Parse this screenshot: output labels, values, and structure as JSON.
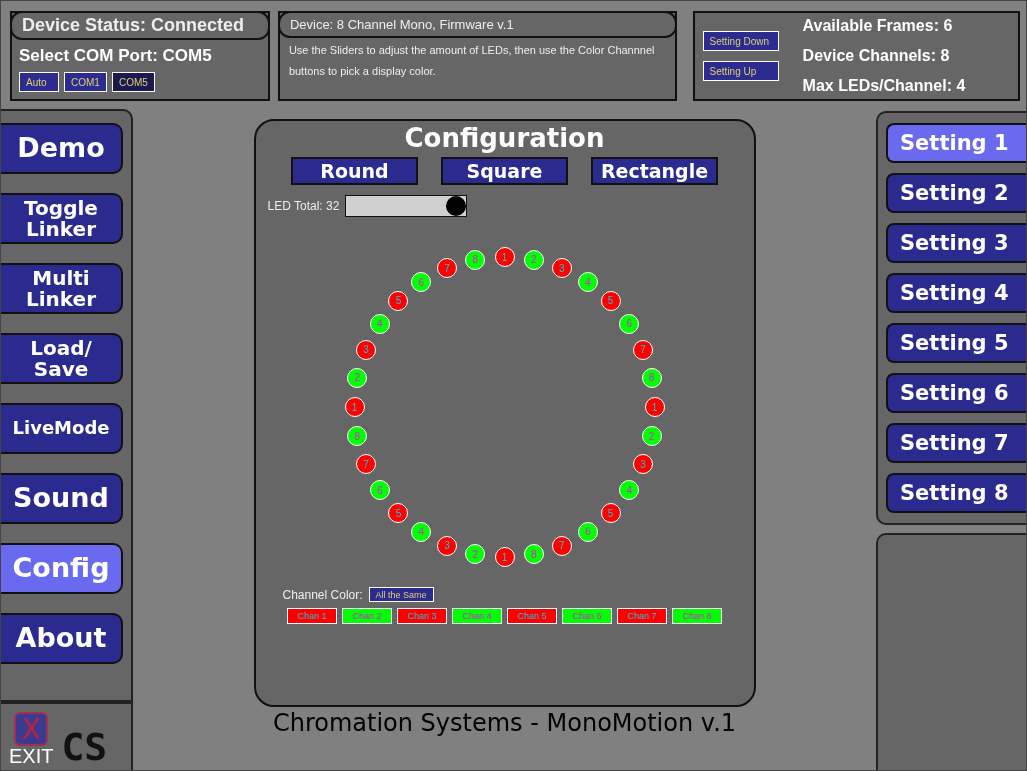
{
  "status": {
    "title": "Device Status: Connected",
    "com_label": "Select COM Port: COM5",
    "ports": [
      {
        "label": "Auto",
        "selected": false
      },
      {
        "label": "COM1",
        "selected": false
      },
      {
        "label": "COM5",
        "selected": true
      }
    ]
  },
  "device": {
    "title": "Device: 8 Channel Mono, Firmware v.1",
    "description": "Use the Sliders to adjust the amount of LEDs, then use the Color Channnel buttons to pick a display color."
  },
  "settings_panel": {
    "buttons": [
      "Setting Down",
      "Setting Up"
    ],
    "info": [
      "Available Frames: 6",
      "Device Channels: 8",
      "Max LEDs/Channel: 4"
    ]
  },
  "sidebar": {
    "items": [
      {
        "label": "Demo",
        "selected": false
      },
      {
        "label": "Toggle Linker",
        "selected": false
      },
      {
        "label": "Multi Linker",
        "selected": false
      },
      {
        "label": "Load/ Save",
        "selected": false
      },
      {
        "label": "LiveMode",
        "selected": false
      },
      {
        "label": "Sound",
        "selected": false
      },
      {
        "label": "Config",
        "selected": true
      },
      {
        "label": "About",
        "selected": false
      }
    ]
  },
  "configuration": {
    "title": "Configuration",
    "shapes": [
      "Round",
      "Square",
      "Rectangle"
    ],
    "led_total": {
      "label": "LED Total: 32",
      "level": 1.0
    },
    "led_ring": {
      "top_arc": [
        {
          "label": "1",
          "color": "#ff0000"
        },
        {
          "label": "2",
          "color": "#00ff00"
        },
        {
          "label": "3",
          "color": "#ff0000"
        },
        {
          "label": "4",
          "color": "#00ff00"
        },
        {
          "label": "5",
          "color": "#ff0000"
        },
        {
          "label": "6",
          "color": "#00ff00"
        },
        {
          "label": "7",
          "color": "#ff0000"
        },
        {
          "label": "8",
          "color": "#00ff00"
        },
        {
          "label": "1",
          "color": "#ff0000"
        },
        {
          "label": "2",
          "color": "#00ff00"
        },
        {
          "label": "3",
          "color": "#ff0000"
        },
        {
          "label": "4",
          "color": "#00ff00"
        },
        {
          "label": "5",
          "color": "#ff0000"
        },
        {
          "label": "6",
          "color": "#00ff00"
        },
        {
          "label": "7",
          "color": "#ff0000"
        },
        {
          "label": "8",
          "color": "#00ff00"
        },
        {
          "label": "1",
          "color": "#ff0000"
        }
      ],
      "bottom_arc": [
        {
          "label": "8",
          "color": "#00ff00"
        },
        {
          "label": "7",
          "color": "#ff0000"
        },
        {
          "label": "6",
          "color": "#00ff00"
        },
        {
          "label": "5",
          "color": "#ff0000"
        },
        {
          "label": "4",
          "color": "#00ff00"
        },
        {
          "label": "3",
          "color": "#ff0000"
        },
        {
          "label": "2",
          "color": "#00ff00"
        },
        {
          "label": "1",
          "color": "#ff0000"
        },
        {
          "label": "8",
          "color": "#00ff00"
        },
        {
          "label": "7",
          "color": "#ff0000"
        },
        {
          "label": "6",
          "color": "#00ff00"
        },
        {
          "label": "5",
          "color": "#ff0000"
        },
        {
          "label": "4",
          "color": "#00ff00"
        },
        {
          "label": "3",
          "color": "#ff0000"
        },
        {
          "label": "2",
          "color": "#00ff00"
        }
      ]
    },
    "channel_color_label": "Channel Color:",
    "all_same_button": "All the Same",
    "channels": [
      {
        "label": "Chan 1",
        "color": "#ff0000"
      },
      {
        "label": "Chan 2",
        "color": "#00ff00"
      },
      {
        "label": "Chan 3",
        "color": "#ff0000"
      },
      {
        "label": "Chan 4",
        "color": "#00ff00"
      },
      {
        "label": "Chan 5",
        "color": "#ff0000"
      },
      {
        "label": "Chan 6",
        "color": "#00ff00"
      },
      {
        "label": "Chan 7",
        "color": "#ff0000"
      },
      {
        "label": "Chan 8",
        "color": "#00ff00"
      }
    ]
  },
  "settings": [
    {
      "label": "Setting 1",
      "selected": true
    },
    {
      "label": "Setting 2",
      "selected": false
    },
    {
      "label": "Setting 3",
      "selected": false
    },
    {
      "label": "Setting 4",
      "selected": false
    },
    {
      "label": "Setting 5",
      "selected": false
    },
    {
      "label": "Setting 6",
      "selected": false
    },
    {
      "label": "Setting 7",
      "selected": false
    },
    {
      "label": "Setting 8",
      "selected": false
    }
  ],
  "exit": {
    "icon_text": "X",
    "label": "EXIT",
    "logo_text": "CS"
  },
  "footer": "Chromation Systems - MonoMotion v.1"
}
